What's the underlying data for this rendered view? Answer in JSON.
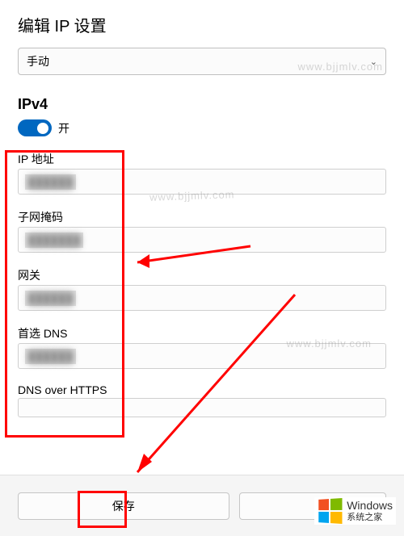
{
  "title": "编辑 IP 设置",
  "mode_select": {
    "value": "手动"
  },
  "ipv4": {
    "heading": "IPv4",
    "toggle_state": "开"
  },
  "fields": {
    "ip": {
      "label": "IP 地址",
      "value": "██████"
    },
    "subnet": {
      "label": "子网掩码",
      "value": "███████"
    },
    "gateway": {
      "label": "网关",
      "value": "██████"
    },
    "dns1": {
      "label": "首选 DNS",
      "value": "██████"
    },
    "dns_https": {
      "label": "DNS over HTTPS"
    }
  },
  "buttons": {
    "save": "保存"
  },
  "watermark": "www.bjjmlv.com",
  "footer": {
    "brand": "Windows",
    "tagline": "系统之家"
  }
}
